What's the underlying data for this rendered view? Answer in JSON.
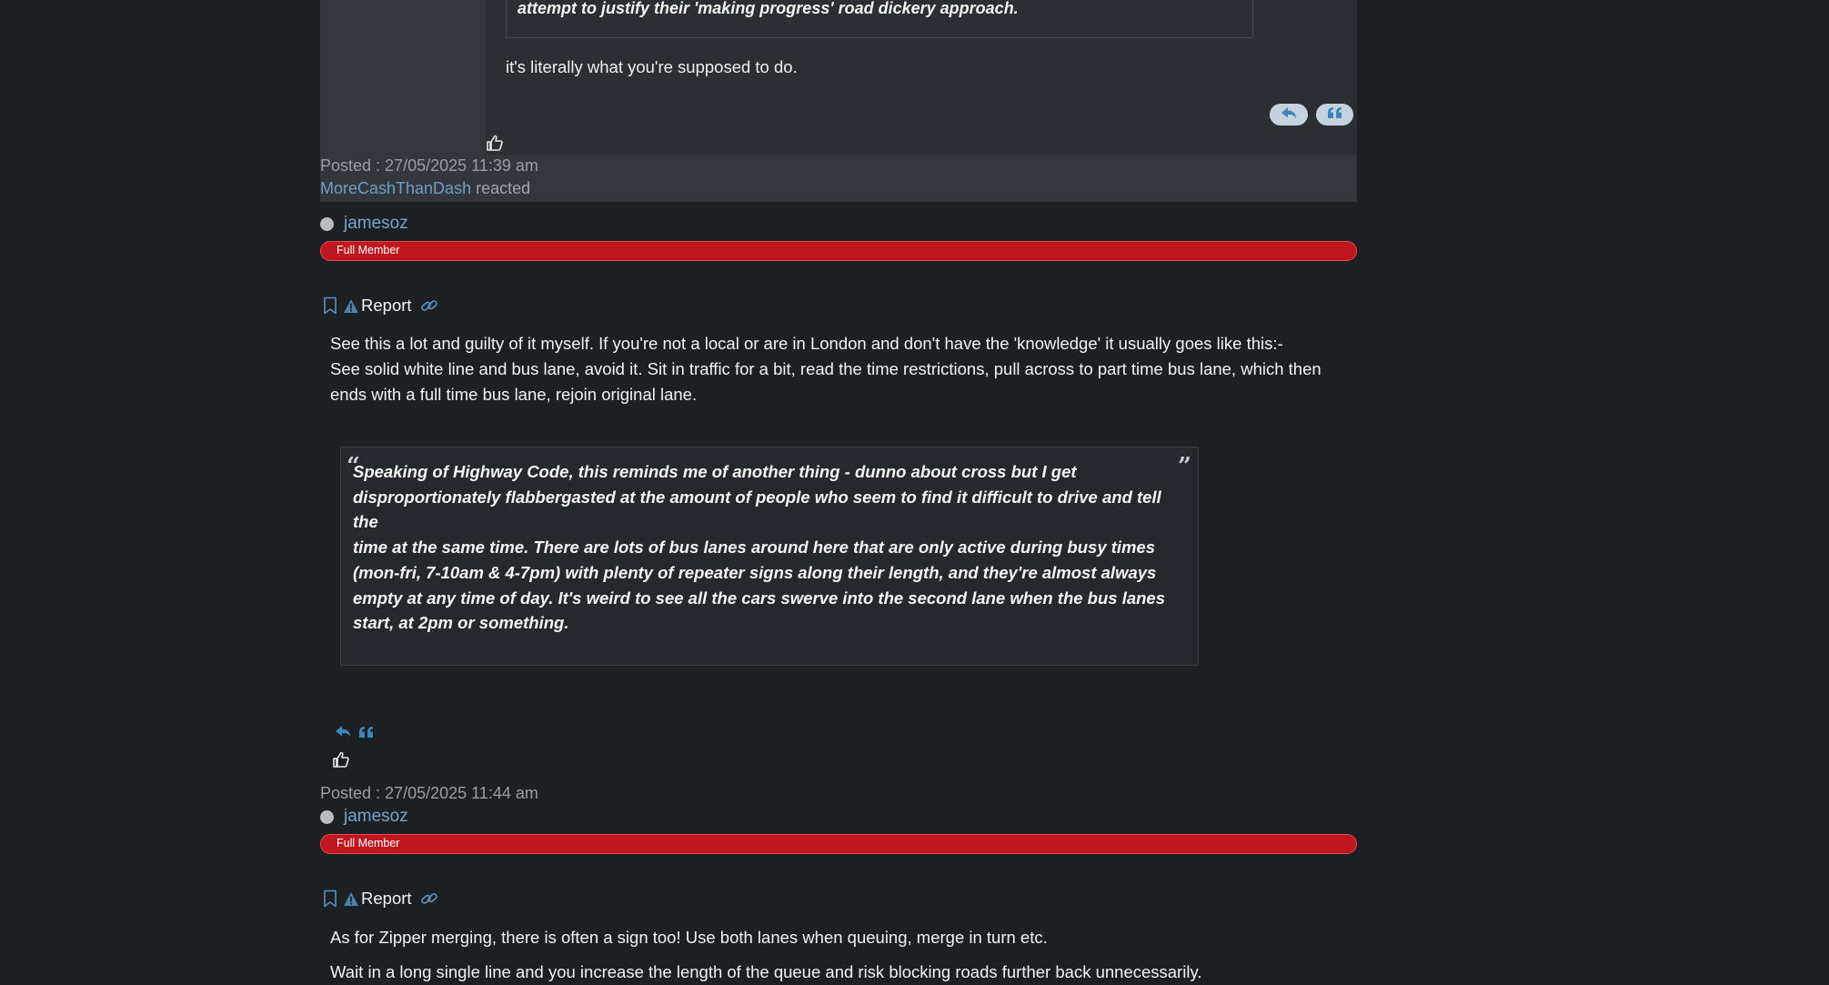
{
  "post1": {
    "quote_text": "attempt to justify their 'making progress' road dickery approach.",
    "body": "it's literally what you're supposed to do.",
    "posted": "Posted : 27/05/2025 11:39 am",
    "reactor": "MoreCashThanDash",
    "reacted_label": "reacted"
  },
  "post2": {
    "author": "jamesoz",
    "rank": "Full Member",
    "report_label": "Report",
    "body_lines": [
      "See this a lot and guilty of it myself. If you're not a local or are in London and don't have the 'knowledge' it usually goes like this:-",
      "See solid white line and bus lane, avoid it. Sit in traffic for a bit, read the time restrictions, pull across to part time bus lane, which then",
      "ends with a full time bus lane, rejoin original lane."
    ],
    "quote_lines": [
      "Speaking of Highway Code, this reminds me of another thing - dunno about cross but I get",
      "disproportionately flabbergasted at the amount of people who seem to find it difficult to drive and tell the",
      "time at the same time. There are lots of bus lanes around here that are only active during busy times",
      "(mon-fri, 7-10am & 4-7pm) with plenty of repeater signs along their length, and they're almost always",
      "empty at any time of day. It's weird to see all the cars swerve into the second lane when the bus lanes",
      "start, at 2pm or something."
    ],
    "posted": "Posted : 27/05/2025 11:44 am"
  },
  "post3": {
    "author": "jamesoz",
    "rank": "Full Member",
    "report_label": "Report",
    "body_lines": [
      "As for Zipper merging, there is often a sign too! Use both lanes when queuing, merge in turn etc.",
      "Wait in a long single line and you increase the length of the queue and risk blocking roads further back unnecessarily."
    ]
  },
  "icons": {
    "reply": "reply-arrow-icon",
    "quote": "quote-icon",
    "like": "thumbs-up-icon",
    "bookmark": "bookmark-icon",
    "report": "warning-triangle-icon",
    "link": "link-icon"
  },
  "colors": {
    "background": "#1d2023",
    "post_background": "#2b2e32",
    "rank_bar": "#c01620",
    "link": "#7aa3c8"
  }
}
